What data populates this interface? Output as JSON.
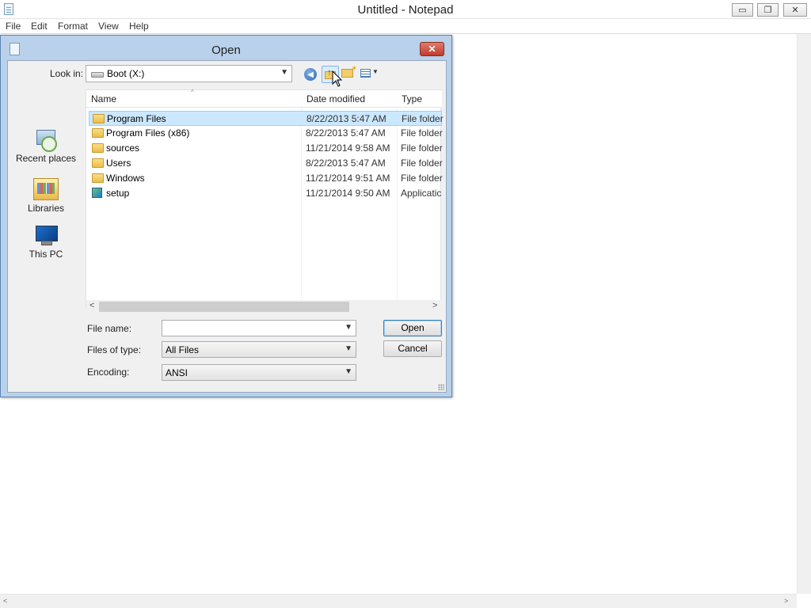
{
  "notepad": {
    "title": "Untitled - Notepad",
    "menu": [
      "File",
      "Edit",
      "Format",
      "View",
      "Help"
    ],
    "window_buttons": {
      "minimize": "▭",
      "maximize": "❐",
      "close": "✕"
    }
  },
  "dialog": {
    "title": "Open",
    "close_glyph": "✕",
    "look_in": {
      "label": "Look in:",
      "value": "Boot (X:)"
    },
    "toolbar": {
      "back_icon": "back-arrow-icon",
      "up_icon": "up-folder-icon",
      "new_folder_icon": "new-folder-icon",
      "views_icon": "views-menu-icon"
    },
    "places": [
      {
        "label": "Recent places",
        "icon": "recent-places-icon"
      },
      {
        "label": "Libraries",
        "icon": "libraries-icon"
      },
      {
        "label": "This PC",
        "icon": "this-pc-icon"
      }
    ],
    "columns": [
      "Name",
      "Date modified",
      "Type"
    ],
    "sort_indicator": "^",
    "files": [
      {
        "name": "Program Files",
        "date": "8/22/2013 5:47 AM",
        "type": "File folder",
        "icon": "folder-icon",
        "selected": true
      },
      {
        "name": "Program Files (x86)",
        "date": "8/22/2013 5:47 AM",
        "type": "File folder",
        "icon": "folder-icon"
      },
      {
        "name": "sources",
        "date": "11/21/2014 9:58 AM",
        "type": "File folder",
        "icon": "folder-icon"
      },
      {
        "name": "Users",
        "date": "8/22/2013 5:47 AM",
        "type": "File folder",
        "icon": "folder-icon"
      },
      {
        "name": "Windows",
        "date": "11/21/2014 9:51 AM",
        "type": "File folder",
        "icon": "folder-icon"
      },
      {
        "name": "setup",
        "date": "11/21/2014 9:50 AM",
        "type": "Applicatic",
        "icon": "application-icon"
      }
    ],
    "file_name": {
      "label": "File name:",
      "value": ""
    },
    "files_of_type": {
      "label": "Files of type:",
      "value": "All Files"
    },
    "encoding": {
      "label": "Encoding:",
      "value": "ANSI"
    },
    "buttons": {
      "open": "Open",
      "cancel": "Cancel"
    }
  }
}
